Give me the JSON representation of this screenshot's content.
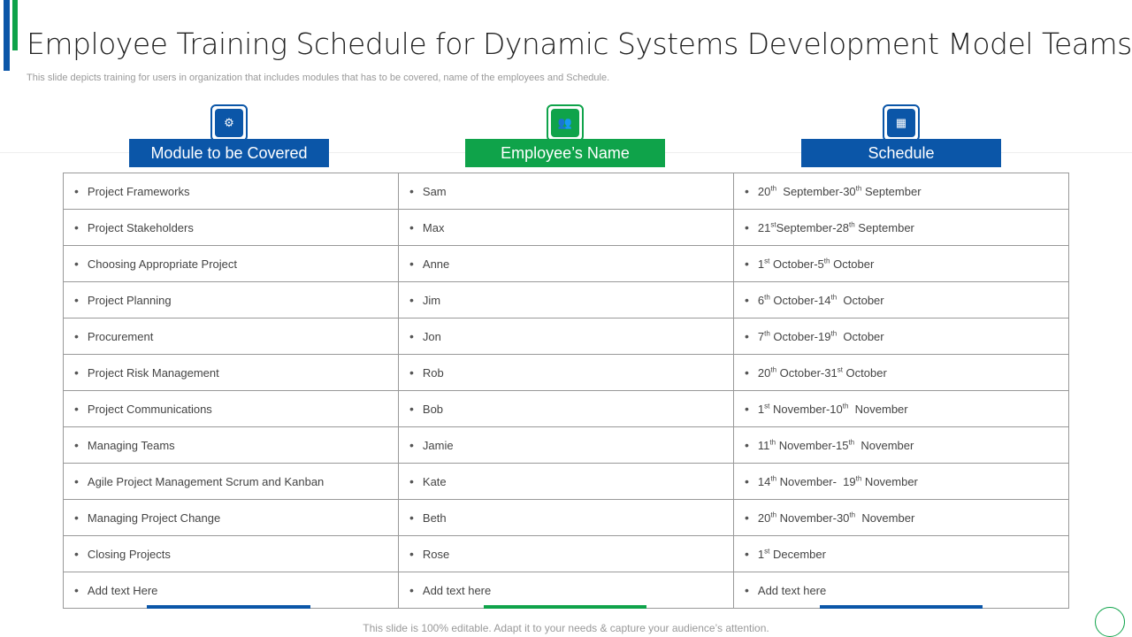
{
  "title": "Employee Training Schedule for Dynamic Systems Development Model Teams",
  "subtitle": "This slide depicts training for users in organization that includes modules that has to be covered, name of the employees and Schedule.",
  "colors": {
    "blue": "#0b56a8",
    "green": "#0fa34a"
  },
  "headers": [
    {
      "label": "Module to be Covered",
      "icon": "org-chart-icon"
    },
    {
      "label": "Employee’s Name",
      "icon": "users-icon"
    },
    {
      "label": "Schedule",
      "icon": "calendar-clock-icon"
    }
  ],
  "modules": [
    "Project Frameworks",
    "Project Stakeholders",
    "Choosing Appropriate Project",
    "Project Planning",
    "Procurement",
    "Project Risk Management",
    "Project Communications",
    "Managing Teams",
    "Agile Project Management Scrum  and Kanban",
    "Managing Project Change",
    "Closing Projects",
    "Add text Here"
  ],
  "employees": [
    "Sam",
    "Max",
    "Anne",
    "Jim",
    "Jon",
    "Rob",
    "Bob",
    "Jamie",
    "Kate",
    "Beth",
    "Rose",
    "Add text here"
  ],
  "schedule": [
    [
      "20",
      "th",
      "  September-30",
      "th",
      " September"
    ],
    [
      "21",
      "st",
      "September-28",
      "th",
      " September"
    ],
    [
      "1",
      "st",
      " October-5",
      "th",
      " October"
    ],
    [
      "6",
      "th",
      " October-14",
      "th",
      "  October"
    ],
    [
      "7",
      "th",
      " October-19",
      "th",
      "  October"
    ],
    [
      "20",
      "th",
      " October-31",
      "st",
      " October"
    ],
    [
      "1",
      "st",
      " November-10",
      "th",
      "  November"
    ],
    [
      "11",
      "th",
      " November-15",
      "th",
      "  November"
    ],
    [
      "14",
      "th",
      " November-  19",
      "th",
      " November"
    ],
    [
      "20",
      "th",
      " November-30",
      "th",
      "  November"
    ],
    [
      "1",
      "st",
      " December"
    ],
    [
      "Add text here"
    ]
  ],
  "footer": "This slide is 100% editable. Adapt it to your needs & capture your audience’s attention."
}
